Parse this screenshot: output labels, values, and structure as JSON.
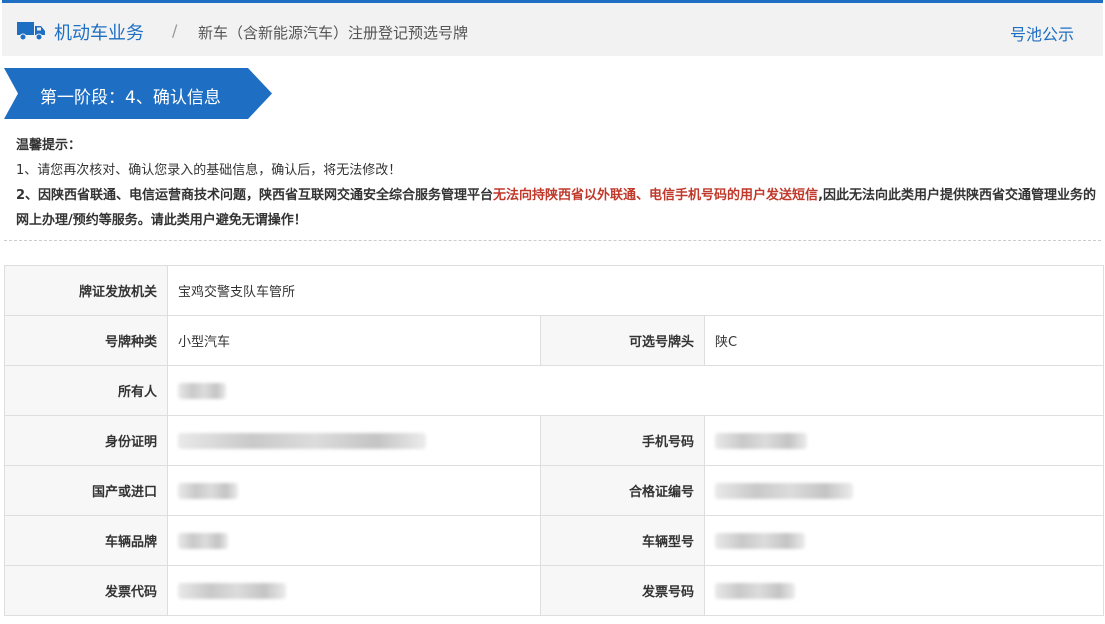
{
  "header": {
    "home_label": "机动车业务",
    "separator": "/",
    "current_label": "新车（含新能源汽车）注册登记预选号牌",
    "pool_link": "号池公示",
    "accent_color": "#1e6fc4"
  },
  "stage": {
    "label": "第一阶段：4、确认信息"
  },
  "tips": {
    "title": "温馨提示：",
    "line1": "1、请您再次核对、确认您录入的基础信息，确认后，将无法修改！",
    "line2_prefix": "2、因陕西省联通、电信运营商技术问题，陕西省互联网交通安全综合服务管理平台",
    "line2_red": "无法向持陕西省以外联通、电信手机号码的用户发送短信",
    "line2_suffix": ",因此无法向此类用户提供陕西省交通管理业务的网上办理/预约等服务。请此类用户避免无谓操作！"
  },
  "form": {
    "issuing_authority": {
      "label": "牌证发放机关",
      "value": "宝鸡交警支队车管所"
    },
    "plate_type": {
      "label": "号牌种类",
      "value": "小型汽车"
    },
    "plate_prefix": {
      "label": "可选号牌头",
      "value": "陕C"
    },
    "owner": {
      "label": "所有人"
    },
    "id_card": {
      "label": "身份证明"
    },
    "phone": {
      "label": "手机号码"
    },
    "origin": {
      "label": "国产或进口"
    },
    "cert_no": {
      "label": "合格证编号"
    },
    "brand": {
      "label": "车辆品牌"
    },
    "model": {
      "label": "车辆型号"
    },
    "invoice_code": {
      "label": "发票代码"
    },
    "invoice_no": {
      "label": "发票号码"
    }
  }
}
